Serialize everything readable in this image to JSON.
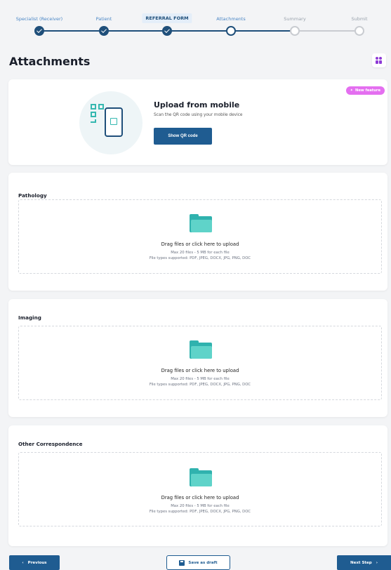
{
  "stepper": {
    "steps": [
      {
        "label": "Specialist (Receiver)",
        "state": "done"
      },
      {
        "label": "Patient",
        "state": "done"
      },
      {
        "label": "REFERRAL FORM",
        "state": "done"
      },
      {
        "label": "Attachments",
        "state": "active"
      },
      {
        "label": "Summary",
        "state": "todo"
      },
      {
        "label": "Submit",
        "state": "todo"
      }
    ]
  },
  "page": {
    "title": "Attachments"
  },
  "mobile_upload": {
    "badge": "New feature",
    "title": "Upload from mobile",
    "description": "Scan the QR code using your mobile device",
    "button": "Show QR code"
  },
  "sections": [
    {
      "title": "Pathology",
      "drop_text": "Drag files or click here to upload",
      "limits": "Max 20 files - 5 MB for each file",
      "types": "File types supported: PDF, JPEG, DOCX, JPG, PNG, DOC"
    },
    {
      "title": "Imaging",
      "drop_text": "Drag files or click here to upload",
      "limits": "Max 20 files - 5 MB for each file",
      "types": "File types supported: PDF, JPEG, DOCX, JPG, PNG, DOC"
    },
    {
      "title": "Other Correspondence",
      "drop_text": "Drag files or click here to upload",
      "limits": "Max 20 files - 5 MB for each file",
      "types": "File types supported: PDF, JPEG, DOCX, JPG, PNG, DOC"
    }
  ],
  "footer": {
    "previous": "Previous",
    "save_draft": "Save as draft",
    "next": "Next Step"
  },
  "colors": {
    "primary": "#1f5c91",
    "accent_teal": "#30b2ae",
    "badge": "#e46ff0"
  },
  "icons": {
    "mobile_illustration": "qr-phone-icon",
    "folder": "folder-icon",
    "help": "people-icon",
    "save": "save-icon"
  }
}
